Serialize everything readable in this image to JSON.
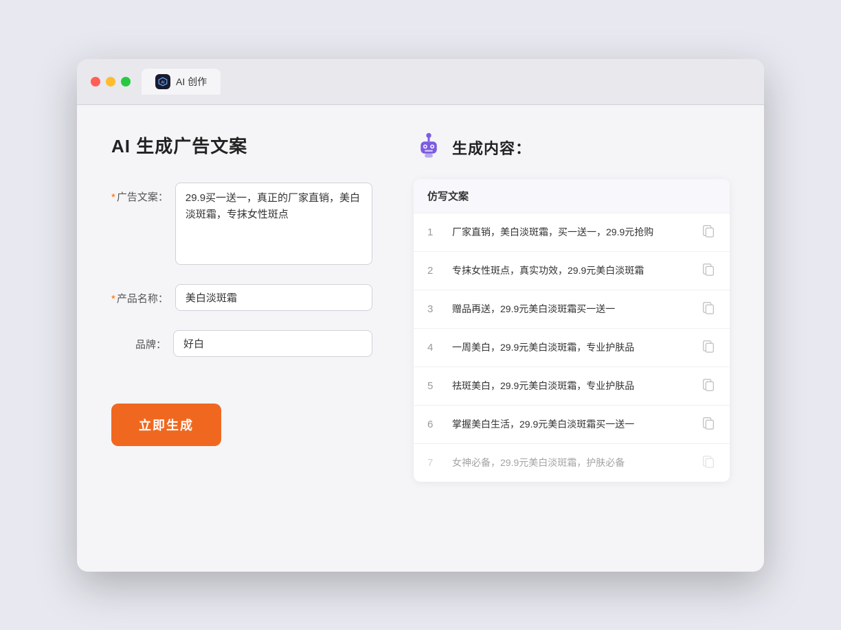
{
  "window": {
    "tab_label": "AI 创作"
  },
  "left": {
    "title": "AI 生成广告文案",
    "fields": [
      {
        "id": "ad-copy",
        "label": "广告文案：",
        "required": true,
        "type": "textarea",
        "value": "29.9买一送一，真正的厂家直销，美白淡斑霜，专抹女性斑点"
      },
      {
        "id": "product-name",
        "label": "产品名称：",
        "required": true,
        "type": "input",
        "value": "美白淡斑霜"
      },
      {
        "id": "brand",
        "label": "品牌：",
        "required": false,
        "type": "input",
        "value": "好白"
      }
    ],
    "button_label": "立即生成"
  },
  "right": {
    "title": "生成内容：",
    "table_header": "仿写文案",
    "rows": [
      {
        "num": "1",
        "text": "厂家直销，美白淡斑霜，买一送一，29.9元抢购",
        "dimmed": false
      },
      {
        "num": "2",
        "text": "专抹女性斑点，真实功效，29.9元美白淡斑霜",
        "dimmed": false
      },
      {
        "num": "3",
        "text": "赠品再送，29.9元美白淡斑霜买一送一",
        "dimmed": false
      },
      {
        "num": "4",
        "text": "一周美白，29.9元美白淡斑霜，专业护肤品",
        "dimmed": false
      },
      {
        "num": "5",
        "text": "祛斑美白，29.9元美白淡斑霜，专业护肤品",
        "dimmed": false
      },
      {
        "num": "6",
        "text": "掌握美白生活，29.9元美白淡斑霜买一送一",
        "dimmed": false
      },
      {
        "num": "7",
        "text": "女神必备，29.9元美白淡斑霜，护肤必备",
        "dimmed": true
      }
    ]
  },
  "colors": {
    "accent": "#f06820",
    "required": "#ff6600",
    "primary": "#5555ee"
  }
}
